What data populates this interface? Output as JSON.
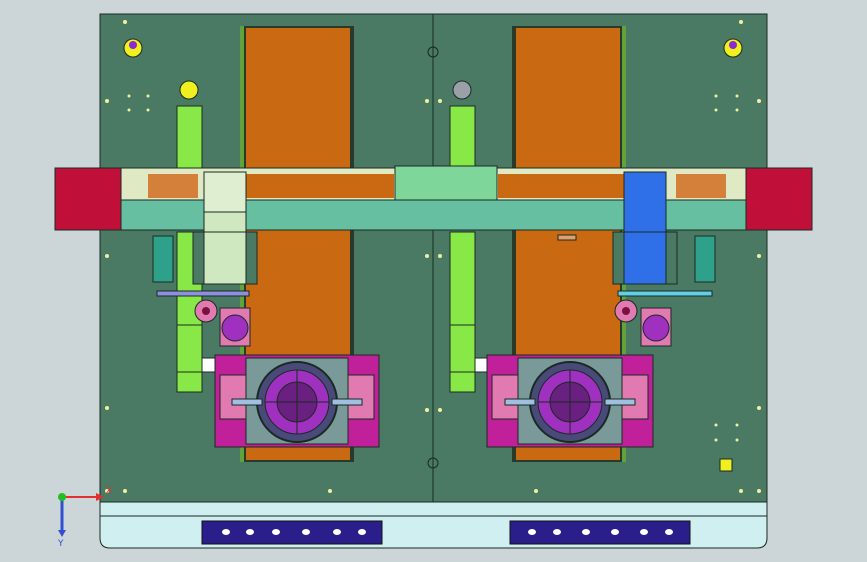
{
  "viewport": {
    "background": "#ccd6d8"
  },
  "colors": {
    "plate": "#4a7a64",
    "plate_edge": "#1a2a22",
    "belt": "#c96a12",
    "belt_rail": "#2a3a2a",
    "beam": "#66bfa0",
    "beam_top": "#dfe9c4",
    "beam_center": "#7fd69a",
    "end_block": "#c0103a",
    "roller_copper": "#d4803a",
    "green_arm": "#88e848",
    "left_carriage": "#cfe8c0",
    "right_carriage": "#2f6fe8",
    "fixture_magenta": "#c0209a",
    "fixture_violet": "#a030c0",
    "fixture_pink": "#e07ab0",
    "bottom_strip": "#cfeff0",
    "slot_panel": "#2a1f8a",
    "yellow_marker": "#f0f020",
    "grey_marker": "#9aa0a8",
    "teal_sensor": "#2fa08a"
  },
  "axis_triad": {
    "x_label": "X",
    "y_label": "Y",
    "x_color": "#e03030",
    "y_color": "#3050d0",
    "origin_color": "#20c020"
  },
  "icons": {
    "axis_triad": "axis-triad-icon",
    "locating_pin": "locating-pin-icon",
    "round_marker": "round-marker-icon"
  }
}
